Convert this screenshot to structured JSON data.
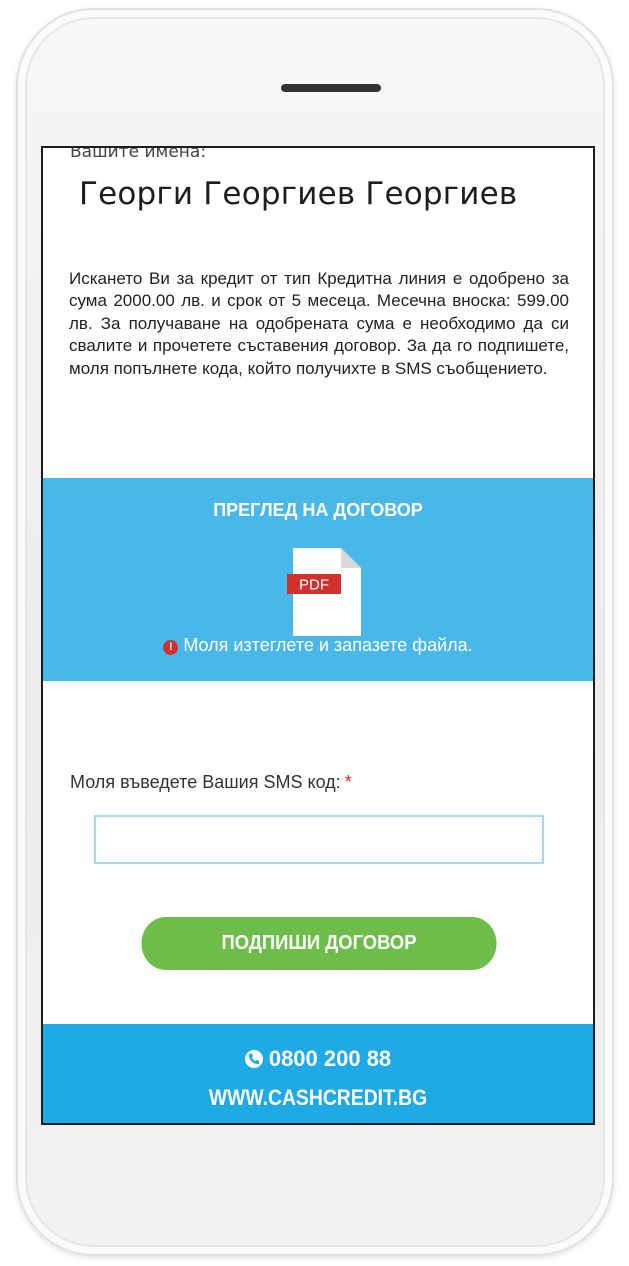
{
  "name_section": {
    "label": "Вашите имена:",
    "value": "Георги Георгиев Георгиев"
  },
  "info_text": "Искането Ви за кредит от тип Кредитна линия е одобрено за сума 2000.00 лв. и срок от 5 месеца. Месечна вноска: 599.00 лв. За получаване на одобрената сума е необходимо да си свалите и прочетете съставения договор. За да го подпишете, моля попълнете кода, който получихте в SMS съобщението.",
  "contract": {
    "title": "ПРЕГЛЕД НА ДОГОВОР",
    "pdf_label": "PDF",
    "notice": "Моля изтеглете и запазете файла.",
    "notice_icon_glyph": "!"
  },
  "sms": {
    "label": "Моля въведете Вашия SMS код:",
    "required_marker": "*",
    "value": "",
    "placeholder": ""
  },
  "sign_button": "ПОДПИШИ ДОГОВОР",
  "footer": {
    "phone": "0800 200 88",
    "website": "WWW.CASHCREDIT.BG"
  },
  "icons": {
    "document": "pdf-file-icon",
    "alert": "exclamation-icon",
    "phone": "phone-icon"
  },
  "colors": {
    "contract_bg": "#4ab7e9",
    "footer_bg": "#1fa9e5",
    "button_bg": "#6dbd4a",
    "alert_red": "#d0312d",
    "pdf_red": "#d0312d"
  }
}
